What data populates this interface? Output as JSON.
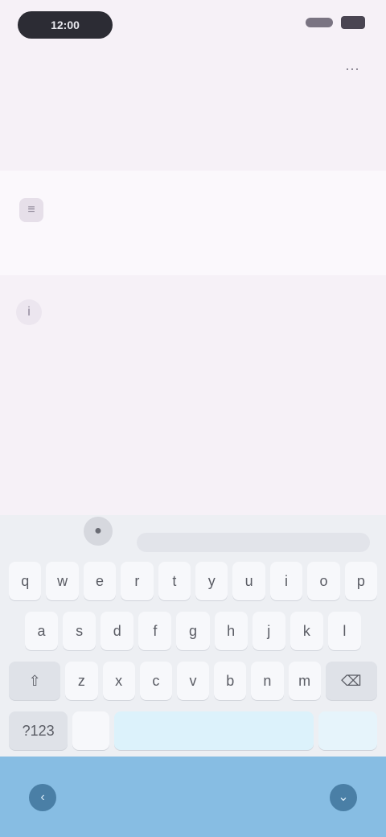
{
  "status_bar": {
    "time": "12:00"
  },
  "header": {
    "action_icon": "more-icon"
  },
  "title_block": {
    "title": "",
    "subtitle": ""
  },
  "card": {
    "icon": "document-icon"
  },
  "list_item": {
    "icon": "info-icon",
    "text": ""
  },
  "keyboard": {
    "toolbar_icon": "mic-icon",
    "rows": [
      [
        "q",
        "w",
        "e",
        "r",
        "t",
        "y",
        "u",
        "i",
        "o",
        "p"
      ],
      [
        "a",
        "s",
        "d",
        "f",
        "g",
        "h",
        "j",
        "k",
        "l"
      ],
      [
        "⇧",
        "z",
        "x",
        "c",
        "v",
        "b",
        "n",
        "m",
        "⌫"
      ],
      [
        "?123",
        "",
        "",
        ""
      ]
    ]
  },
  "nav": {
    "left_icon": "back-icon",
    "right_icon": "keyboard-hide-icon"
  },
  "colors": {
    "background": "#f6f1f7",
    "nav_bar": "#87bde3",
    "keyboard": "#edeff3"
  }
}
